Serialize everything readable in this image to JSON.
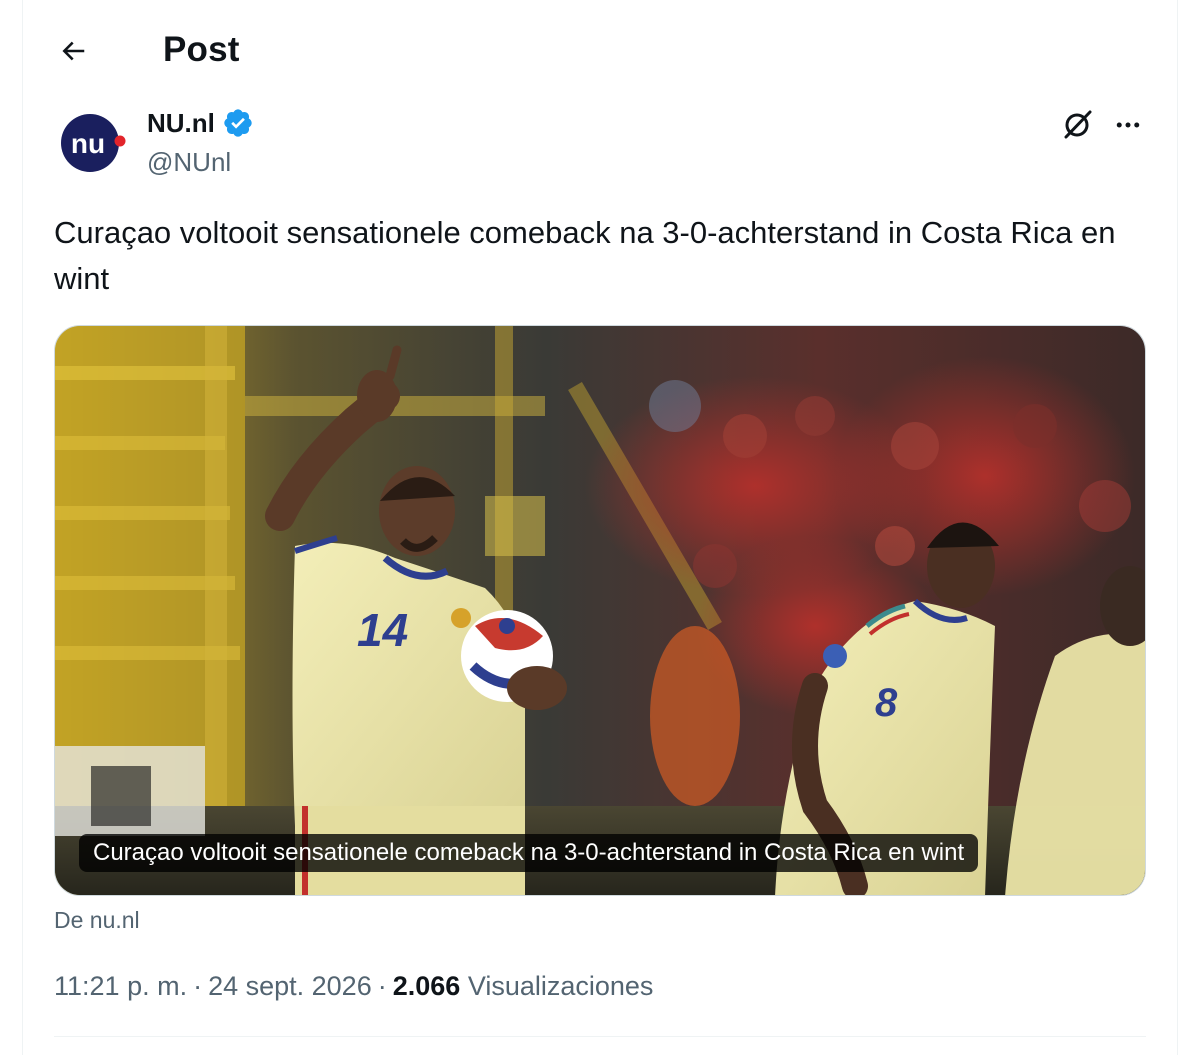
{
  "header": {
    "back_icon": "arrow-left-icon",
    "title": "Post"
  },
  "author": {
    "avatar_text": "nu",
    "name": "NU.nl",
    "handle": "@NUnl",
    "verified_icon": "verified-badge-icon",
    "verified_color": "#1d9bf0",
    "avatar_color": "#1a1f5e",
    "avatar_accent": "#e2242b"
  },
  "actions": {
    "grok_icon": "grok-icon",
    "more_icon": "more-options-icon"
  },
  "post": {
    "text": "Curaçao voltooit sensationele comeback na 3-0-achterstand in Costa Rica en wint"
  },
  "media": {
    "caption": "Curaçao voltooit sensationele comeback na 3-0-achterstand in Costa Rica en wint",
    "player_left_number": "14",
    "player_right_number": "8"
  },
  "source": "De nu.nl",
  "meta": {
    "time": "11:21 p. m.",
    "separator": "·",
    "date": "24 sept. 2026",
    "views_count": "2.066",
    "views_label": "Visualizaciones"
  }
}
